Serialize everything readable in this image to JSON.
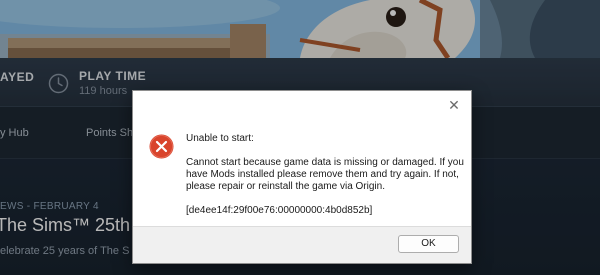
{
  "stats": {
    "played_label": "AYED",
    "playtime_title": "PLAY TIME",
    "playtime_value": "119 hours"
  },
  "nav": {
    "community_hub": "y Hub",
    "points_shop": "Points Sh"
  },
  "news": {
    "date": "EWS - FEBRUARY 4",
    "title": "The Sims™ 25th Bir",
    "description": "elebrate 25 years of The S"
  },
  "dialog": {
    "heading": "Unable to start:",
    "message": "Cannot start because game data is missing or damaged. If you have Mods installed please remove them and try again.  If not, please repair or reinstall the game via Origin.",
    "error_code": "[de4ee14f:29f00e76:00000000:4b0d852b]",
    "ok_label": "OK",
    "close_glyph": "✕"
  },
  "colors": {
    "error_red": "#d9442c",
    "background": "#1b2838"
  }
}
